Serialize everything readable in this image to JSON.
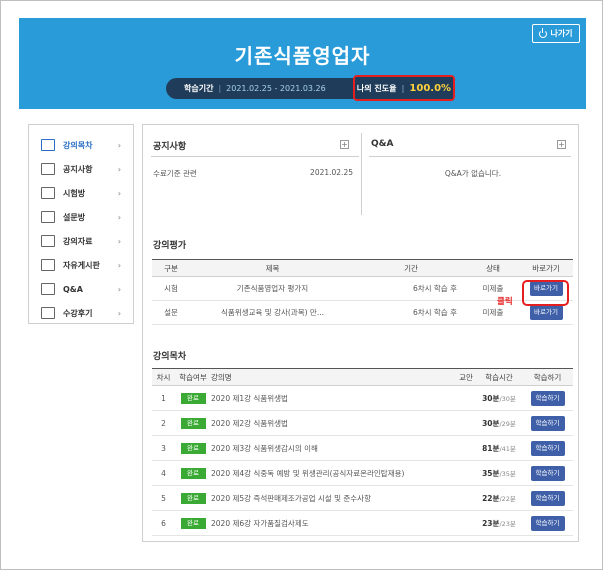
{
  "header": {
    "title": "기존식품영업자",
    "exit_label": "나가기",
    "period_label": "학습기간",
    "period_dates": "2021.02.25 - 2021.03.26",
    "progress_label": "나의 진도율",
    "progress_value": "100.0%",
    "colors": {
      "header_bg": "#2a9bd9",
      "pill_bg": "#1f3d5a",
      "highlight": "#e51f1f",
      "progress_value": "#ffd23a"
    }
  },
  "sidebar": {
    "items": [
      {
        "label": "강의목차",
        "icon": "lecture-icon",
        "active": true
      },
      {
        "label": "공지사항",
        "icon": "notice-icon"
      },
      {
        "label": "시험방",
        "icon": "exam-icon"
      },
      {
        "label": "설문방",
        "icon": "survey-icon"
      },
      {
        "label": "강의자료",
        "icon": "materials-icon"
      },
      {
        "label": "자유게시판",
        "icon": "board-icon"
      },
      {
        "label": "Q&A",
        "icon": "qa-icon"
      },
      {
        "label": "수강후기",
        "icon": "review-icon"
      }
    ]
  },
  "notice": {
    "title": "공지사항",
    "items": [
      {
        "text": "수료기준 관련",
        "date": "2021.02.25"
      }
    ]
  },
  "qa": {
    "title": "Q&A",
    "empty_text": "Q&A가 없습니다."
  },
  "evaluation": {
    "title": "강의평가",
    "columns": [
      "구분",
      "제목",
      "기간",
      "상태",
      "바로가기"
    ],
    "rows": [
      {
        "type": "시험",
        "title": "기존식품영업자 평가지",
        "period": "6차시 학습 후",
        "status": "미제출",
        "button": "바로가기"
      },
      {
        "type": "설문",
        "title": "식품위생교육 및 강사(과목) 만...",
        "period": "6차시 학습 후",
        "status": "미제출",
        "button": "바로가기"
      }
    ],
    "click_label": "클릭"
  },
  "lectures": {
    "title": "강의목차",
    "columns": [
      "차시",
      "학습여부",
      "강의명",
      "교안",
      "학습시간",
      "학습하기"
    ],
    "rows": [
      {
        "no": "1",
        "status": "완료",
        "name": "2020 제1강 식품위생법",
        "time_done": "30분",
        "time_total": "/30분",
        "button": "학습하기"
      },
      {
        "no": "2",
        "status": "완료",
        "name": "2020 제2강 식품위생법",
        "time_done": "30분",
        "time_total": "/29분",
        "button": "학습하기"
      },
      {
        "no": "3",
        "status": "완료",
        "name": "2020 제3강 식품위생감시의 이해",
        "time_done": "81분",
        "time_total": "/41분",
        "button": "학습하기"
      },
      {
        "no": "4",
        "status": "완료",
        "name": "2020 제4강 식중독 예방 및 위생관리(공식자료온라인탑재용)",
        "time_done": "35분",
        "time_total": "/35분",
        "button": "학습하기"
      },
      {
        "no": "5",
        "status": "완료",
        "name": "2020 제5강 즉석판매제조가공업 시설 및 준수사항",
        "time_done": "22분",
        "time_total": "/22분",
        "button": "학습하기"
      },
      {
        "no": "6",
        "status": "완료",
        "name": "2020 제6강 자가품질검사제도",
        "time_done": "23분",
        "time_total": "/23분",
        "button": "학습하기"
      }
    ]
  }
}
